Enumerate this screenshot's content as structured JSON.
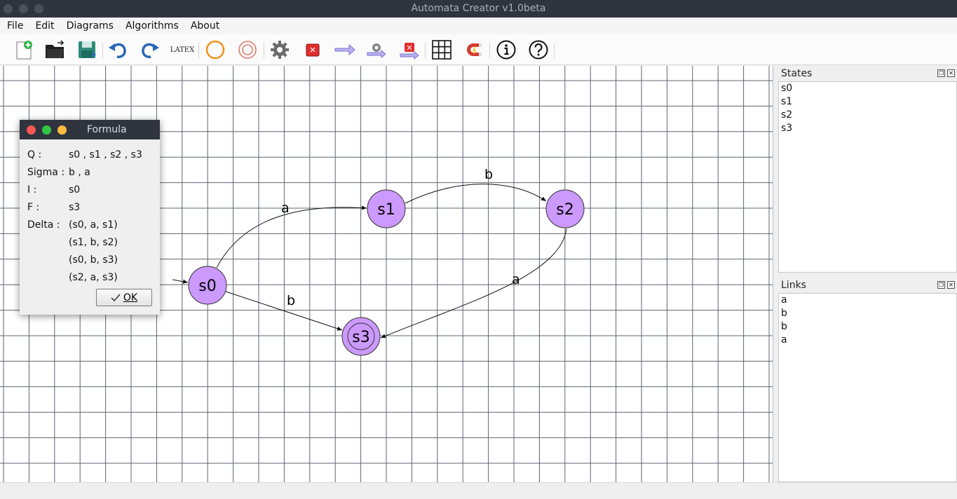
{
  "window": {
    "title": "Automata Creator v1.0beta"
  },
  "menu": [
    "File",
    "Edit",
    "Diagrams",
    "Algorithms",
    "About"
  ],
  "toolbar": {
    "latex_label": "LATEX",
    "tools": [
      "new-file-icon",
      "open-file-icon",
      "save-icon",
      "undo-icon",
      "redo-icon",
      "latex-icon",
      "state-icon",
      "final-state-icon",
      "settings-gear-icon",
      "delete-icon",
      "link-arrow-icon",
      "link-settings-icon",
      "delete-link-icon",
      "grid-icon",
      "magnet-icon",
      "info-icon",
      "help-icon"
    ]
  },
  "diagram": {
    "states": [
      {
        "id": "s0",
        "label": "s0",
        "initial": true,
        "final": false
      },
      {
        "id": "s1",
        "label": "s1",
        "initial": false,
        "final": false
      },
      {
        "id": "s2",
        "label": "s2",
        "initial": false,
        "final": false
      },
      {
        "id": "s3",
        "label": "s3",
        "initial": false,
        "final": true
      }
    ],
    "links": [
      {
        "from": "s0",
        "to": "s1",
        "label": "a"
      },
      {
        "from": "s1",
        "to": "s2",
        "label": "b"
      },
      {
        "from": "s0",
        "to": "s3",
        "label": "b"
      },
      {
        "from": "s2",
        "to": "s3",
        "label": "a"
      }
    ],
    "state_color": "#cc99ff"
  },
  "states_panel": {
    "title": "States",
    "items": [
      "s0",
      "s1",
      "s2",
      "s3"
    ]
  },
  "links_panel": {
    "title": "Links",
    "items": [
      "a",
      "b",
      "b",
      "a"
    ]
  },
  "formula_dialog": {
    "title": "Formula",
    "q_label": "Q :",
    "q_value": "s0 , s1 , s2 , s3",
    "sigma_label": "Sigma :",
    "sigma_value": "b , a",
    "i_label": "I :",
    "i_value": "s0",
    "f_label": "F :",
    "f_value": "s3",
    "delta_label": "Delta :",
    "delta_values": [
      "(s0, a, s1)",
      "(s1, b, s2)",
      "(s0, b, s3)",
      "(s2, a, s3)"
    ],
    "ok_label": "OK"
  }
}
